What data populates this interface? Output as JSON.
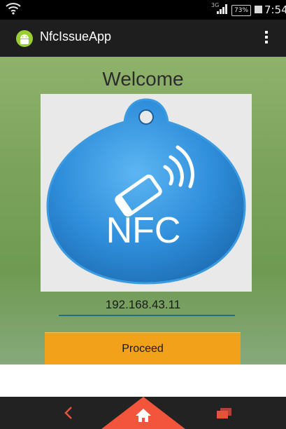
{
  "status_bar": {
    "network_type": "3G",
    "battery_percent": "73%",
    "time": "7:54"
  },
  "action_bar": {
    "title": "NfcIssueApp",
    "icons": {
      "app": "android-app-icon",
      "overflow": "overflow-menu-icon"
    }
  },
  "main": {
    "heading": "Welcome",
    "nfc_image_text": "NFC",
    "ip_value": "192.168.43.11",
    "proceed_label": "Proceed"
  },
  "nav_bar": {
    "icons": [
      "back-icon",
      "home-icon",
      "recent-apps-icon"
    ]
  },
  "colors": {
    "action_bar": "#1e1e1e",
    "content_green": "#7ca35c",
    "nfc_tag_blue": "#2f8edb",
    "proceed_button": "#f2a11a",
    "ip_underline": "#1f6f93",
    "nav_home_accent": "#f2553b"
  }
}
